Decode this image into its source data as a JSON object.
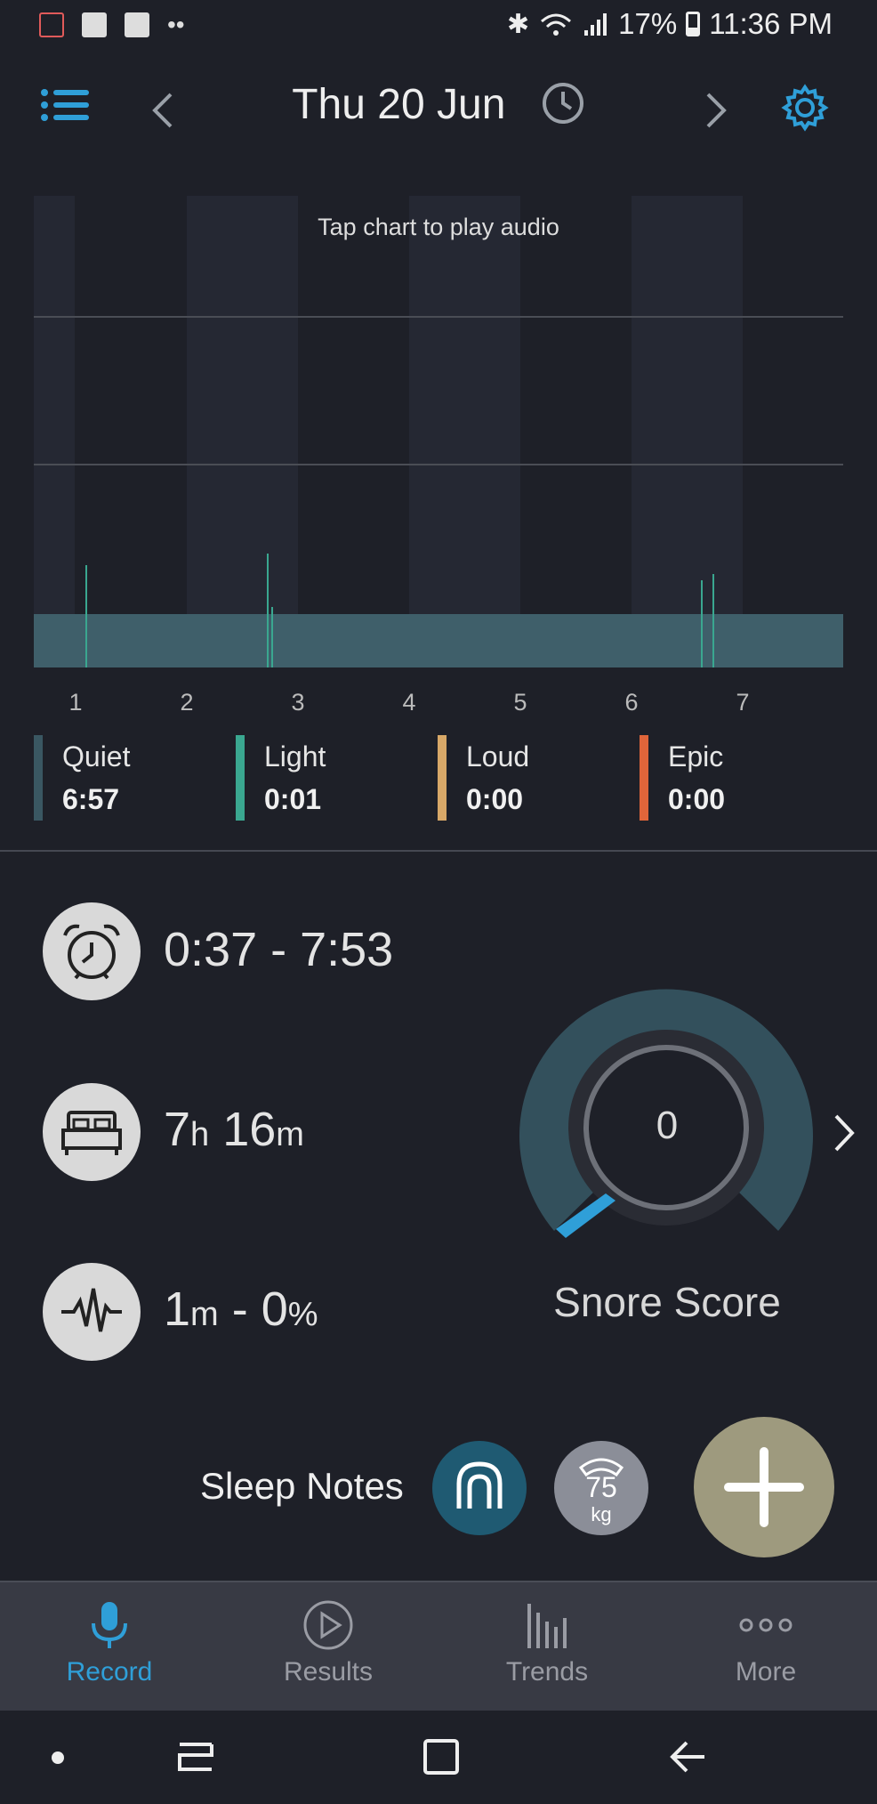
{
  "status_bar": {
    "battery": "17%",
    "time": "11:36 PM",
    "icons": [
      "notification-icon",
      "gallery-icon",
      "font-icon",
      "more-dots-icon",
      "bluetooth-icon",
      "wifi-icon",
      "signal-icon",
      "battery-icon"
    ]
  },
  "header": {
    "date": "Thu 20 Jun",
    "accent": "#2f9fd8"
  },
  "chart": {
    "hint": "Tap chart to play audio",
    "x_ticks": [
      "1",
      "2",
      "3",
      "4",
      "5",
      "6",
      "7"
    ]
  },
  "chart_data": {
    "type": "area",
    "x_ticks": [
      "1",
      "2",
      "3",
      "4",
      "5",
      "6",
      "7"
    ],
    "series": [
      {
        "name": "Quiet",
        "color": "#3f5f6a"
      },
      {
        "name": "Light",
        "color": "#3aa790"
      }
    ],
    "grid": true
  },
  "legend": [
    {
      "name": "Quiet",
      "value": "6:57",
      "color": "#3a5762"
    },
    {
      "name": "Light",
      "value": "0:01",
      "color": "#3aa790"
    },
    {
      "name": "Loud",
      "value": "0:00",
      "color": "#d8a868"
    },
    {
      "name": "Epic",
      "value": "0:00",
      "color": "#e0653a"
    }
  ],
  "stats": {
    "time_range": "0:37 - 7:53",
    "duration_h": "7",
    "duration_h_unit": "h",
    "duration_m": "16",
    "duration_m_unit": "m",
    "snore_m": "1",
    "snore_m_unit": "m",
    "snore_sep": " - ",
    "snore_pct": "0",
    "snore_pct_unit": "%"
  },
  "snore_score": {
    "value": "0",
    "label": "Snore Score"
  },
  "sleep_notes": {
    "label": "Sleep Notes",
    "weight_value": "75",
    "weight_unit": "kg"
  },
  "nav": [
    {
      "label": "Record",
      "active": true
    },
    {
      "label": "Results",
      "active": false
    },
    {
      "label": "Trends",
      "active": false
    },
    {
      "label": "More",
      "active": false
    }
  ]
}
